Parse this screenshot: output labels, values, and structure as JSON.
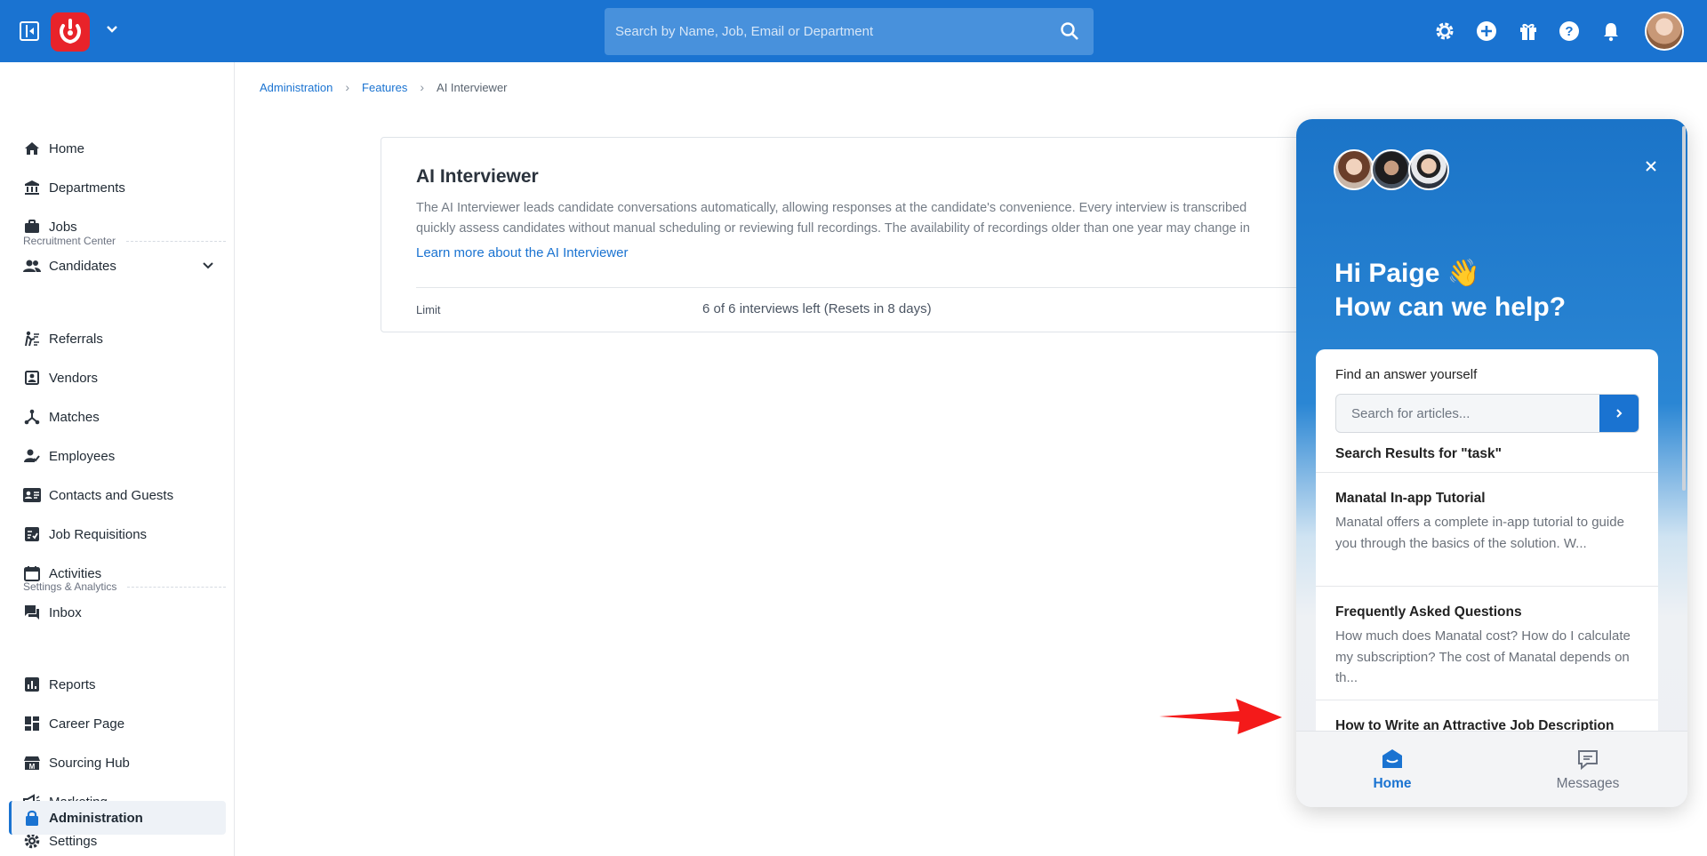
{
  "topbar": {
    "search_placeholder": "Search by Name, Job, Email or Department",
    "accent": "#1a73d1",
    "logo_color": "#e8232a",
    "icons": [
      "sidebar-toggle-icon",
      "app-logo",
      "chevron-down-icon",
      "search-icon",
      "gear-icon",
      "plus-circle-icon",
      "gift-icon",
      "help-icon",
      "bell-icon",
      "avatar"
    ]
  },
  "sidebar": {
    "items": [
      {
        "label": "Home",
        "icon": "home-icon"
      },
      {
        "label": "Departments",
        "icon": "bank-icon"
      },
      {
        "label": "Jobs",
        "icon": "briefcase-icon"
      },
      {
        "label": "Candidates",
        "icon": "people-icon"
      },
      {
        "label": "Referrals",
        "icon": "referral-icon"
      },
      {
        "label": "Vendors",
        "icon": "vendor-icon"
      },
      {
        "label": "Matches",
        "icon": "hub-icon"
      },
      {
        "label": "Employees",
        "icon": "employee-icon"
      },
      {
        "label": "Contacts and Guests",
        "icon": "contact-card-icon"
      },
      {
        "label": "Job Requisitions",
        "icon": "checklist-icon"
      },
      {
        "label": "Activities",
        "icon": "calendar-icon"
      },
      {
        "label": "Inbox",
        "icon": "chat-icon"
      },
      {
        "label": "Reports",
        "icon": "bar-chart-icon"
      },
      {
        "label": "Career Page",
        "icon": "dashboard-icon"
      },
      {
        "label": "Sourcing Hub",
        "icon": "sourcing-icon"
      },
      {
        "label": "Marketing",
        "icon": "megaphone-icon"
      },
      {
        "label": "Settings",
        "icon": "gear-icon"
      },
      {
        "label": "Administration",
        "icon": "lock-icon"
      }
    ],
    "sections": {
      "recruitment": "Recruitment Center",
      "settings": "Settings & Analytics"
    }
  },
  "breadcrumb": {
    "items": [
      "Administration",
      "Features",
      "AI Interviewer"
    ]
  },
  "card": {
    "title": "AI Interviewer",
    "desc_line1": "The AI Interviewer leads candidate conversations automatically, allowing responses at the candidate's convenience. Every interview is transcribed",
    "desc_line2": "quickly assess candidates without manual scheduling or reviewing full recordings. The availability of recordings older than one year may change in",
    "link": "Learn more about the AI Interviewer",
    "limit_label": "Limit",
    "limit_value": "6 of 6 interviews left (Resets in 8 days)"
  },
  "widget": {
    "greeting_line1": "Hi Paige 👋",
    "greeting_line2": "How can we help?",
    "find_label": "Find an answer yourself",
    "search_placeholder": "Search for articles...",
    "results_title": "Search Results for \"task\"",
    "articles": [
      {
        "title": "Manatal In-app Tutorial",
        "body": "Manatal offers a complete in-app tutorial to guide you through the basics of the solution. W..."
      },
      {
        "title": "Frequently Asked Questions",
        "body": "How much does Manatal cost? How do I calculate my subscription? The cost of Manatal depends on th..."
      },
      {
        "title": "How to Write an Attractive Job Description",
        "body": ""
      }
    ],
    "tabs": {
      "home": "Home",
      "messages": "Messages"
    }
  }
}
